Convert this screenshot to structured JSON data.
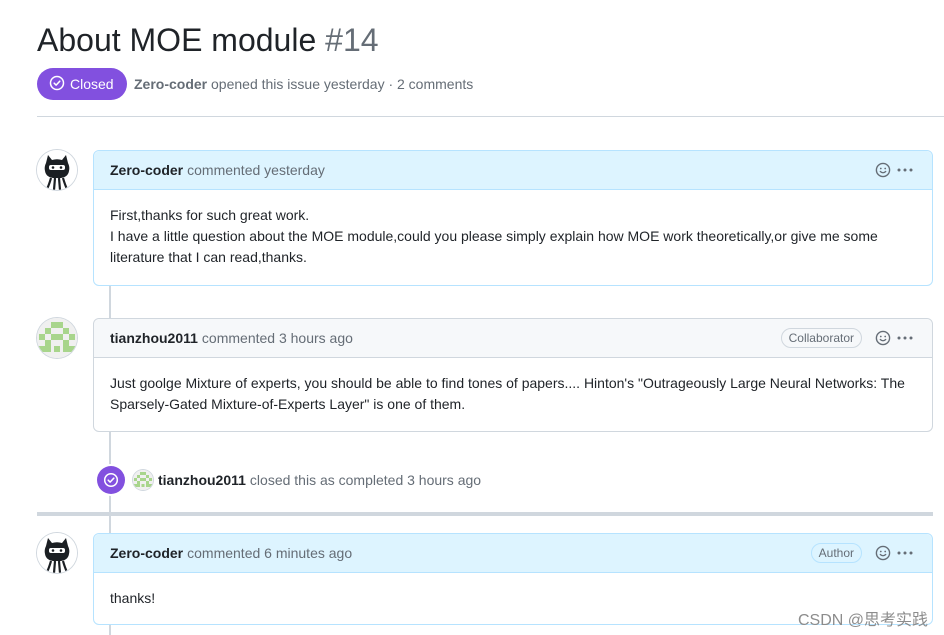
{
  "issue": {
    "title": "About MOE module",
    "number": "#14",
    "state": "Closed",
    "opener": "Zero-coder",
    "opened_text": "opened this issue yesterday · 2 comments"
  },
  "comments": [
    {
      "author": "Zero-coder",
      "action": "commented yesterday",
      "label": "",
      "lines": [
        "First,thanks for such great work.",
        "I have a little question about the MOE module,could you please simply explain how MOE work theoretically,or give me some literature that I can read,thanks."
      ]
    },
    {
      "author": "tianzhou2011",
      "action": "commented 3 hours ago",
      "label": "Collaborator",
      "lines": [
        "Just goolge Mixture of experts, you should be able to find tones of papers.... Hinton's \"Outrageously Large Neural Networks: The Sparsely-Gated Mixture-of-Experts Layer\" is one of them."
      ]
    },
    {
      "author": "Zero-coder",
      "action": "commented 6 minutes ago",
      "label": "Author",
      "lines": [
        "thanks!"
      ]
    }
  ],
  "event": {
    "actor": "tianzhou2011",
    "text": "closed this as completed 3 hours ago"
  },
  "watermark": "CSDN @思考实践",
  "colors": {
    "closed_purple": "#8250df",
    "comment_header_blue": "#ddf4ff",
    "border": "#d0d7de",
    "muted_text": "#656d76"
  },
  "icons": [
    "check-circle-icon",
    "smiley-icon",
    "kebab-horizontal-icon",
    "octocat-avatar",
    "identicon-avatar"
  ]
}
